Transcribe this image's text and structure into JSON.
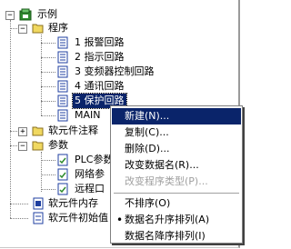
{
  "tree": {
    "root": "示例",
    "program": "程序",
    "routines": [
      "1 报警回路",
      "2 指示回路",
      "3 变频器控制回路",
      "4 通讯回路",
      "5 保护回路",
      "MAIN"
    ],
    "comments": "软元件注释",
    "params": "参数",
    "param_items": [
      "PLC参数",
      "网络参",
      "远程口"
    ],
    "memory": "软元件内存",
    "init": "软元件初始值"
  },
  "context_menu": {
    "items": [
      {
        "label": "新建(N)..."
      },
      {
        "label": "复制(C)..."
      },
      {
        "label": "删除(D)..."
      },
      {
        "label": "改变数据名(R)..."
      },
      {
        "label": "改变程序类型(P)..."
      },
      {
        "label": "不排序(O)"
      },
      {
        "label": "数据名升序排列(A)",
        "bullet": "•"
      },
      {
        "label": "数据名降序排列(I)"
      }
    ]
  },
  "colors": {
    "selection": "#0a246a",
    "folder": "#f0d860",
    "program_icon": "#1f3fa0",
    "root_icon": "#2e8b2e"
  }
}
